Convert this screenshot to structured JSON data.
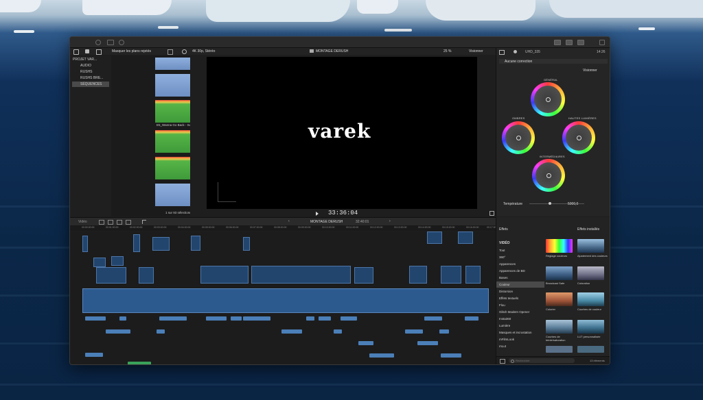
{
  "library": {
    "hide_rejected": "Masquer les plans rejetés",
    "items": [
      "PROJET VAR...",
      "AUDIO",
      "RUSHS",
      "RUSHS BRE...",
      "SÉQUENCES"
    ],
    "clip_name": "E5_Wanna Go Back - Squid",
    "selection_status": "1 sur 93 sélectionné(s), 33:33:02"
  },
  "viewer": {
    "format": "4K 30p, Stéréo",
    "project_name": "MONTAGE DERUSH",
    "zoom": "25 %",
    "view_menu": "Visionner",
    "logo_text": "varek",
    "timecode": "33:36:04"
  },
  "inspector": {
    "clip_id": "UHD_335",
    "duration": "14:26",
    "correction": "Aucune correction",
    "view_menu": "Visionner",
    "wheel_labels": [
      "GÉNÉRAL",
      "OMBRES",
      "HAUTES LUMIÈRES",
      "INTERMÉDIAIRES"
    ],
    "temperature_label": "Température",
    "temperature_value": "5000,0"
  },
  "timeline": {
    "index_label": "Vidéo",
    "project_name": "MONTAGE DERUSH",
    "duration": "32:40:01",
    "ruler": [
      "00:00:00:00",
      "00:01:00:00",
      "00:02:00:00",
      "00:03:00:00",
      "00:04:00:00",
      "00:05:00:00",
      "00:06:00:00",
      "00:07:00:00",
      "00:08:00:00",
      "00:09:00:00",
      "00:10:00:00",
      "00:11:00:00",
      "00:12:00:00",
      "00:13:00:00",
      "00:14:00:00",
      "00:15:00:00",
      "00:16:00:00",
      "00:17:00:00"
    ]
  },
  "effects": {
    "title": "Effets",
    "installed": "Effets installés",
    "section": "VIDÉO",
    "categories": [
      "Tout",
      "360°",
      "Apparences",
      "Apparences de BD",
      "Bases",
      "Couleur",
      "Distorsion",
      "Effets textuels",
      "Flou",
      "Glitch Modern Opener",
      "Insta360",
      "Lumière",
      "Masques et incrustation",
      "mFilmLook",
      "mLut"
    ],
    "selected_category": "Couleur",
    "items": [
      "Réglage couleurs",
      "Ajustement des couleurs",
      "Broadcast Safe",
      "Coloration",
      "Colorier",
      "Courbes de couleur",
      "Courbes de teinte/saturation",
      "LUT personnalisée"
    ],
    "search_placeholder": "Rechercher",
    "count": "13 éléments"
  },
  "colors": {
    "accent": "#4a90e2",
    "timeline_clip": "#2f5d92",
    "audio_clip": "#4b7fb8",
    "selected_row": "#4a4a4a"
  }
}
